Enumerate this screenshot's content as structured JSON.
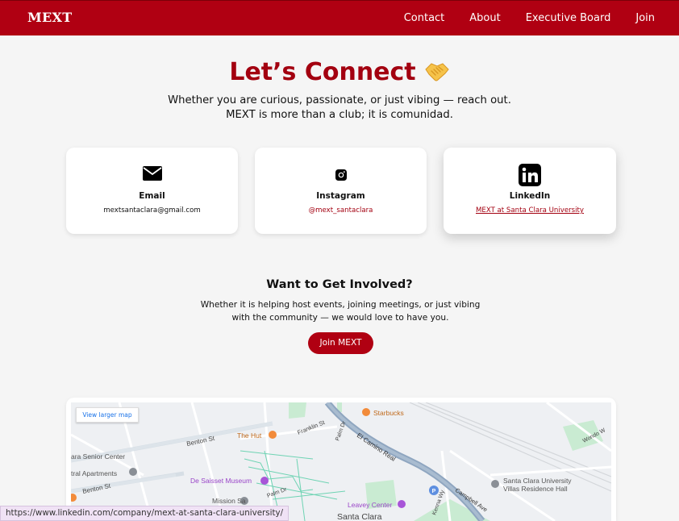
{
  "header": {
    "brand": "MEXT",
    "nav": [
      "Contact",
      "About",
      "Executive Board",
      "Join"
    ]
  },
  "hero": {
    "title": "Let’s Connect",
    "icon": "handshake-icon",
    "intro": "Whether you are curious, passionate, or just vibing — reach out. MEXT is more than a club; it is comunidad."
  },
  "cards": [
    {
      "title": "Email",
      "value": "mextsantaclara@gmail.com",
      "icon": "envelope-icon"
    },
    {
      "title": "Instagram",
      "value": "@mext_santaclara",
      "icon": "instagram-icon"
    },
    {
      "title": "LinkedIn",
      "value": "MEXT at Santa Clara University",
      "icon": "linkedin-icon"
    }
  ],
  "involve": {
    "title": "Want to Get Involved?",
    "text": "Whether it is helping host events, joining meetings, or just vibing with the community — we would love to have you.",
    "button": "Join MEXT"
  },
  "map": {
    "larger_link": "View larger map",
    "labels": {
      "benton1": "Benton St",
      "benton2": "Benton St",
      "senior": "ara Senior Center",
      "apts": "tral Apartments",
      "hut": "The Hut",
      "franklin": "Franklin St",
      "starbucks": "Starbucks",
      "camino": "El Camino Real",
      "palmdr1": "Palm Dr",
      "palmdr2": "Palm Dr",
      "desaisset": "De Saisset Museum",
      "mission": "Mission Sa",
      "leavey": "Leavey Center",
      "scu": "Santa Clara",
      "campbell": "Campbell Ave",
      "villas": "Santa Clara University Villas Residence Hall",
      "wondo": "Wondo W",
      "kenna": "Kenna Wy"
    }
  },
  "status_url": "https://www.linkedin.com/company/mext-at-santa-clara-university/",
  "colors": {
    "brand": "#b00012",
    "title": "#a30010",
    "background": "#f5f5f5"
  }
}
